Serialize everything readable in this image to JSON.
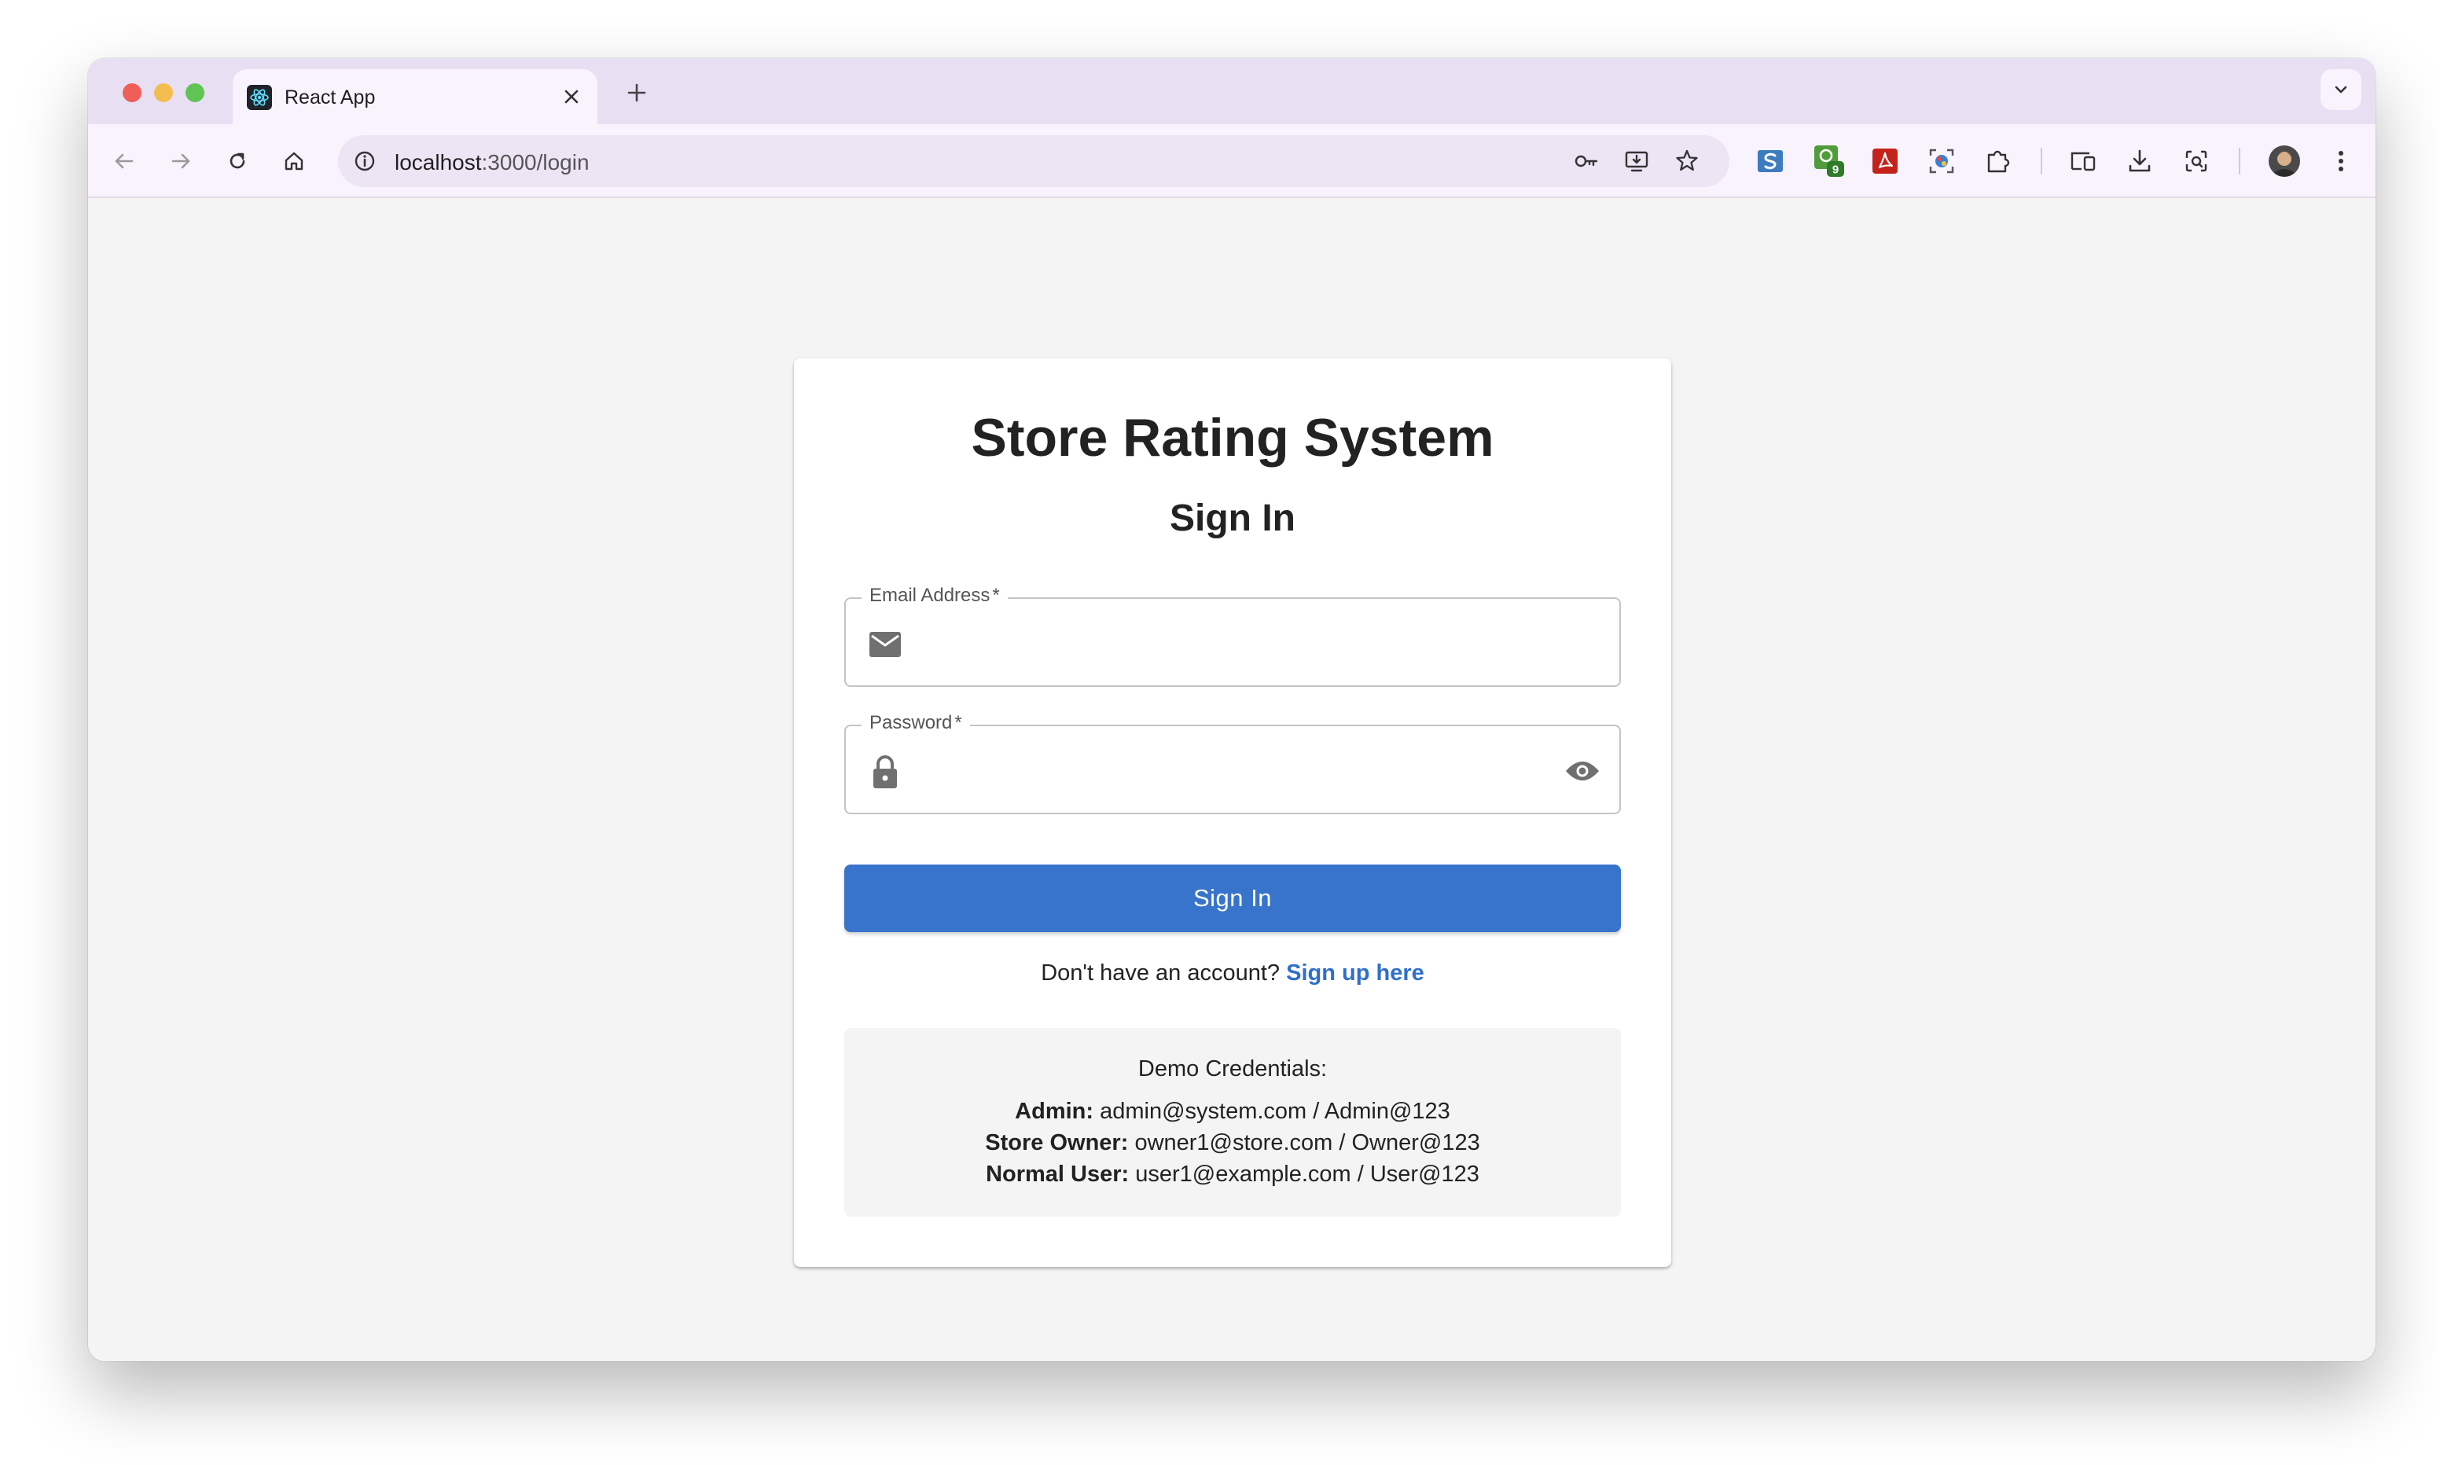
{
  "browser": {
    "tab_title": "React App",
    "url_host": "localhost",
    "url_rest": ":3000/login",
    "extension_badge": "9",
    "colors": {
      "tabstrip": "#e8dff3",
      "toolbar": "#f8f3fc"
    }
  },
  "page": {
    "title": "Store Rating System",
    "subtitle": "Sign In",
    "email": {
      "label": "Email Address",
      "required_mark": "*",
      "value": "",
      "icon": "mail-icon"
    },
    "password": {
      "label": "Password",
      "required_mark": "*",
      "value": "",
      "icon": "lock-icon",
      "toggle_icon": "eye-icon"
    },
    "submit_label": "Sign In",
    "signup_prompt": "Don't have an account?",
    "signup_link": "Sign up here",
    "demo": {
      "title": "Demo Credentials:",
      "accounts": [
        {
          "role": "Admin:",
          "credentials": "admin@system.com / Admin@123"
        },
        {
          "role": "Store Owner:",
          "credentials": "owner1@store.com / Owner@123"
        },
        {
          "role": "Normal User:",
          "credentials": "user1@example.com / User@123"
        }
      ]
    },
    "colors": {
      "primary": "#3874cb",
      "link": "#2f6fcb",
      "background": "#f4f4f4"
    }
  }
}
